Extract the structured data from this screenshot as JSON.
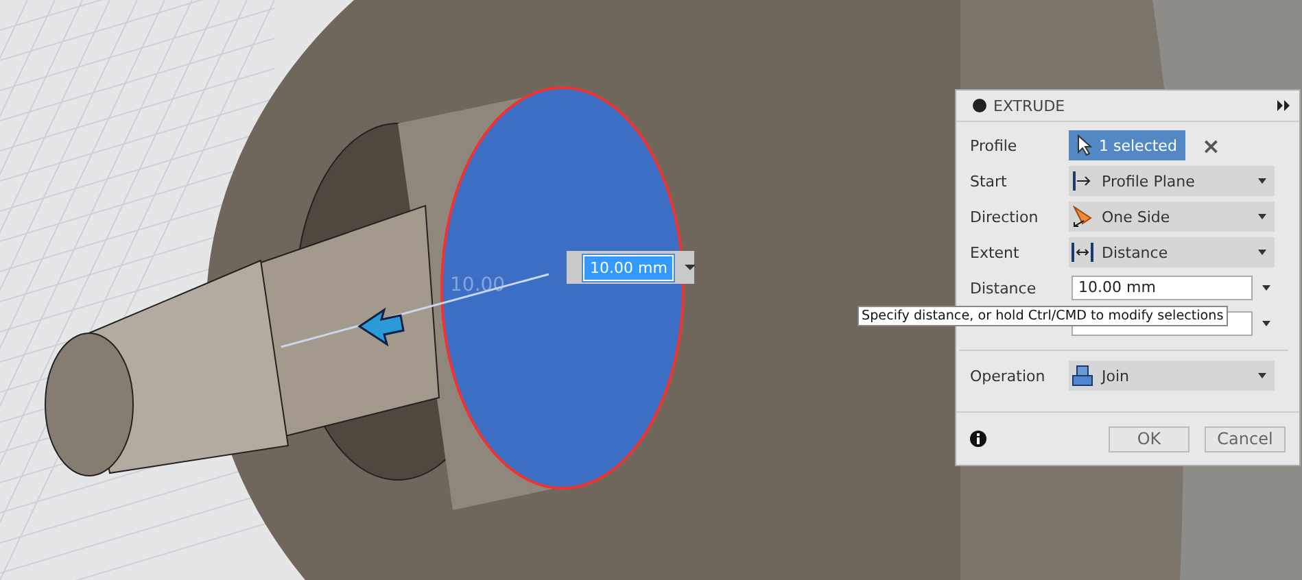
{
  "viewport": {
    "dimension_label": "10.00",
    "dimension_input": {
      "value": "10.00 mm"
    }
  },
  "dialog": {
    "title": "EXTRUDE",
    "rows": [
      {
        "kind": "selection",
        "label": "Profile",
        "value": "1 selected",
        "selected": true,
        "clear": "×"
      },
      {
        "kind": "dropdown",
        "label": "Start",
        "value": "Profile Plane"
      },
      {
        "kind": "dropdown",
        "label": "Direction",
        "value": "One Side"
      },
      {
        "kind": "dropdown",
        "label": "Extent",
        "value": "Distance"
      },
      {
        "kind": "input",
        "label": "Distance",
        "value": "10.00 mm"
      },
      {
        "kind": "input"
      },
      {
        "kind": "divider"
      },
      {
        "kind": "dropdown",
        "label": "Operation",
        "value": "Join"
      }
    ],
    "buttons": [
      "OK",
      "Cancel"
    ]
  },
  "tooltip": "Specify distance, or hold Ctrl/CMD to modify selections"
}
